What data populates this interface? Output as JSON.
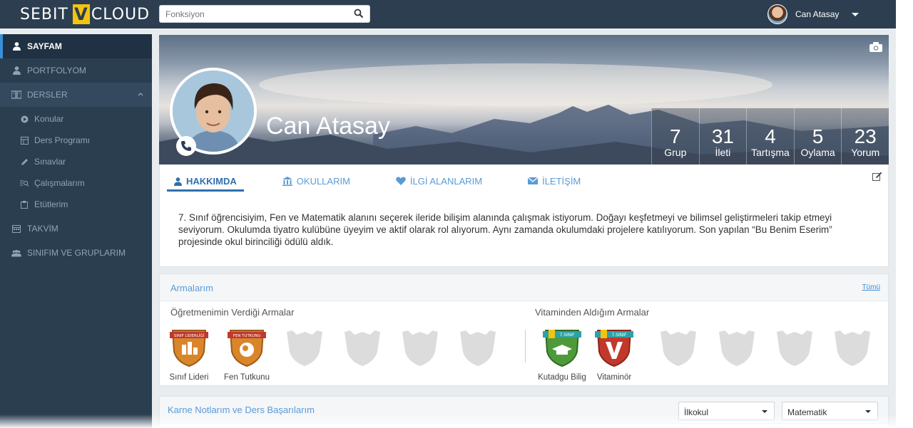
{
  "brand": {
    "left": "SEBIT",
    "mark": "V",
    "right": "CLOUD"
  },
  "search": {
    "placeholder": "Fonksiyon"
  },
  "user": {
    "name": "Can Atasay"
  },
  "sidebar": {
    "items": [
      {
        "label": "SAYFAM",
        "icon": "user-icon"
      },
      {
        "label": "PORTFOLYOM",
        "icon": "user-icon"
      },
      {
        "label": "DERSLER",
        "icon": "book-icon"
      },
      {
        "label": "TAKVİM",
        "icon": "calendar-icon"
      },
      {
        "label": "SINIFIM VE GRUPLARIM",
        "icon": "group-icon"
      }
    ],
    "subitems": [
      {
        "label": "Konular",
        "icon": "play-icon"
      },
      {
        "label": "Ders Programı",
        "icon": "schedule-icon"
      },
      {
        "label": "Sınavlar",
        "icon": "pencil-icon"
      },
      {
        "label": "Çalışmalarım",
        "icon": "list-search-icon"
      },
      {
        "label": "Etütlerim",
        "icon": "clipboard-icon"
      }
    ]
  },
  "profile": {
    "name": "Can Atasay",
    "stats": [
      {
        "value": "7",
        "label": "Grup"
      },
      {
        "value": "31",
        "label": "İleti"
      },
      {
        "value": "4",
        "label": "Tartışma"
      },
      {
        "value": "5",
        "label": "Oylama"
      },
      {
        "value": "23",
        "label": "Yorum"
      }
    ]
  },
  "tabs": [
    {
      "label": "HAKKIMDA",
      "icon": "user-icon"
    },
    {
      "label": "OKULLARIM",
      "icon": "school-icon"
    },
    {
      "label": "İLGİ ALANLARIM",
      "icon": "heart-icon"
    },
    {
      "label": "İLETİŞİM",
      "icon": "envelope-icon"
    }
  ],
  "about": {
    "text": "7. Sınıf öğrencisiyim, Fen ve Matematik alanını seçerek ileride bilişim alanında çalışmak istiyorum. Doğayı keşfetmeyi ve bilimsel geliştirmeleri takip etmeyi seviyorum. Okulumda tiyatro kulübüne üyeyim ve aktif olarak rol alıyorum. Aynı zamanda okulumdaki projelere katılıyorum. Son yapılan “Bu Benim Eserim” projesinde okul birinciliği ödülü aldık."
  },
  "badges": {
    "title": "Armalarım",
    "all_label": "Tümü",
    "teacher_title": "Öğretmenimin Verdiği Armalar",
    "vitamin_title": "Vitaminden Aldığım Armalar",
    "teacher_badges": [
      {
        "caption": "Sınıf Lideri",
        "ribbon": "SINIF LİDERLİĞİ",
        "color": "#e67e22"
      },
      {
        "caption": "Fen Tutkunu",
        "ribbon": "FEN TUTKUNU",
        "color": "#e67e22"
      }
    ],
    "vitamin_badges": [
      {
        "caption": "Kutadgu Bilig",
        "ribbon": "7.SINIF",
        "color": "#4e9a3a"
      },
      {
        "caption": "Vitaminör",
        "ribbon": "7.SINIF",
        "color": "#c0392b"
      }
    ]
  },
  "grades": {
    "title": "Karne Notlarım ve Ders Başarılarım",
    "level_select": "İlkokul",
    "subject_select": "Matematik"
  }
}
